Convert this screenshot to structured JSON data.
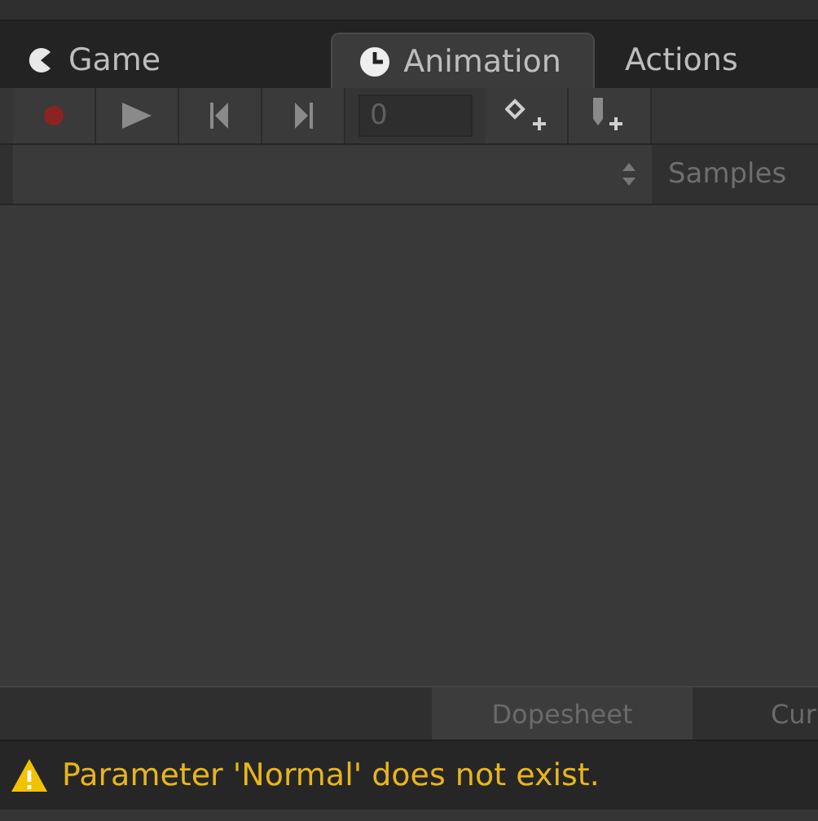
{
  "tabs": [
    {
      "label": "Game",
      "kind": "game",
      "selected": false
    },
    {
      "label": "Animation",
      "kind": "clock",
      "selected": true
    },
    {
      "label": "Actions",
      "kind": "none",
      "selected": false
    }
  ],
  "toolbar": {
    "buttons": [
      {
        "kind": "record"
      },
      {
        "kind": "play"
      },
      {
        "kind": "prev"
      },
      {
        "kind": "next"
      }
    ],
    "frame_field": {
      "value": "0"
    },
    "add_buttons": [
      {
        "kind": "key"
      },
      {
        "kind": "event"
      }
    ]
  },
  "clip_row": {
    "samples_label": "Samples"
  },
  "view_tabs": [
    {
      "label": "Dopesheet",
      "selected": true
    },
    {
      "label": "Cur",
      "selected": false
    }
  ],
  "status_bar": {
    "message": "Parameter 'Normal' does not exist.",
    "kind": "warning"
  }
}
